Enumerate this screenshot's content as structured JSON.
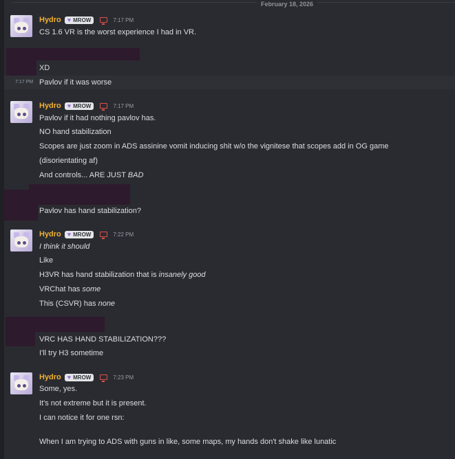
{
  "date_separator": "February 18, 2026",
  "messages": {
    "m1": {
      "author": "Hydro",
      "tag": "MROW",
      "time": "7:17 PM",
      "lines": [
        "CS 1.6 VR is the worst experience I had in VR."
      ]
    },
    "m2": {
      "lines": [
        "XD"
      ]
    },
    "m3": {
      "hover_time": "7:17 PM",
      "lines": [
        "Pavlov if it was worse"
      ]
    },
    "m4": {
      "author": "Hydro",
      "tag": "MROW",
      "time": "7:17 PM",
      "lines": [
        "Pavlov if it had nothing pavlov has.",
        "NO hand stabilization",
        "Scopes are just zoom in ADS assinine vomit inducing shit w/o the vignitese that scopes add in OG game",
        "(disorientating af)",
        "And controls... ARE JUST ",
        "BAD"
      ]
    },
    "m5": {
      "lines": [
        "Pavlov has hand stabilization?"
      ]
    },
    "m6": {
      "author": "Hydro",
      "tag": "MROW",
      "time": "7:22 PM",
      "lines": [
        "I think it should",
        "Like",
        "H3VR has hand stabilization that is ",
        "insanely good",
        "VRChat has ",
        "some",
        "This (CSVR) has ",
        "none"
      ]
    },
    "m7": {
      "lines": [
        "VRC HAS HAND STABILIZATION???",
        "I'll try H3 sometime"
      ]
    },
    "m8": {
      "author": "Hydro",
      "tag": "MROW",
      "time": "7:23 PM",
      "lines": [
        "Some, yes.",
        "It's not extreme but it is present.",
        "I can notice it for one rsn:",
        "When I am trying to ADS with guns in like, some maps, my hands don't shake like lunatic"
      ]
    }
  },
  "icons": {
    "tag_icon": "heart-icon",
    "platform_icon": "monitor-icon"
  },
  "colors": {
    "username": "#f0b232",
    "platform_icon": "#e0514a",
    "tag_heart": "#9b6bdc"
  }
}
